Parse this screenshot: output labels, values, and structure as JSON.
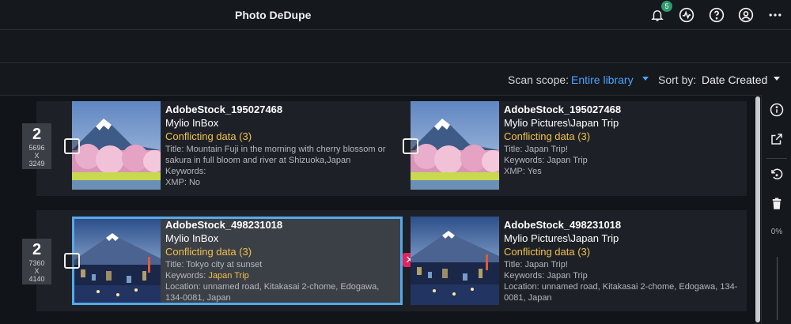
{
  "app": {
    "title": "Photo DeDupe"
  },
  "header": {
    "notification_count": "5",
    "icons": [
      "bell-icon",
      "activity-icon",
      "help-icon",
      "account-icon",
      "more-icon"
    ]
  },
  "scope": {
    "label": "Scan scope:",
    "value": "Entire library",
    "sort_label": "Sort by:",
    "sort_value": "Date Created"
  },
  "groups": [
    {
      "count": "2",
      "dim_w": "5696",
      "dim_x": "X",
      "dim_h": "3249",
      "left": {
        "name": "AdobeStock_195027468",
        "location": "Mylio InBox",
        "conflict": "Conflicting data (3)",
        "title": "Title: Mountain Fuji in the morning with cherry blossom or sakura in full bloom and river at Shizuoka,Japan",
        "keywords_label": "Keywords:",
        "keywords_value": "",
        "xmp": "XMP: No"
      },
      "right": {
        "name": "AdobeStock_195027468",
        "location": "Mylio Pictures\\Japan Trip",
        "conflict": "Conflicting data (3)",
        "title": "Title: Japan Trip!",
        "keywords": "Keywords: Japan Trip",
        "xmp": "XMP: Yes"
      }
    },
    {
      "count": "2",
      "dim_w": "7360",
      "dim_x": "X",
      "dim_h": "4140",
      "left": {
        "name": "AdobeStock_498231018",
        "location": "Mylio InBox",
        "conflict": "Conflicting data (3)",
        "title": "Title: Tokyo city at sunset",
        "keywords_label": "Keywords:",
        "keywords_value": "Japan Trip",
        "address": "Location: unnamed road, Kitakasai 2-chome, Edogawa, 134-0081, Japan"
      },
      "right": {
        "name": "AdobeStock_498231018",
        "location": "Mylio Pictures\\Japan Trip",
        "conflict": "Conflicting data (3)",
        "title": "Title: Japan Trip!",
        "keywords": "Keywords: Japan Trip",
        "address": "Location: unnamed road, Kitakasai 2-chome, Edogawa, 134-0081, Japan"
      }
    }
  ],
  "side_panel": {
    "zoom": "0%",
    "icons": [
      "info-icon",
      "open-external-icon",
      "rotate-icon",
      "trash-icon"
    ]
  },
  "colors": {
    "accent": "#4ea3ff",
    "conflict": "#f2c14e",
    "selection": "#56a9ea",
    "badge": "#2f9a6e",
    "remove": "#e0245e"
  }
}
